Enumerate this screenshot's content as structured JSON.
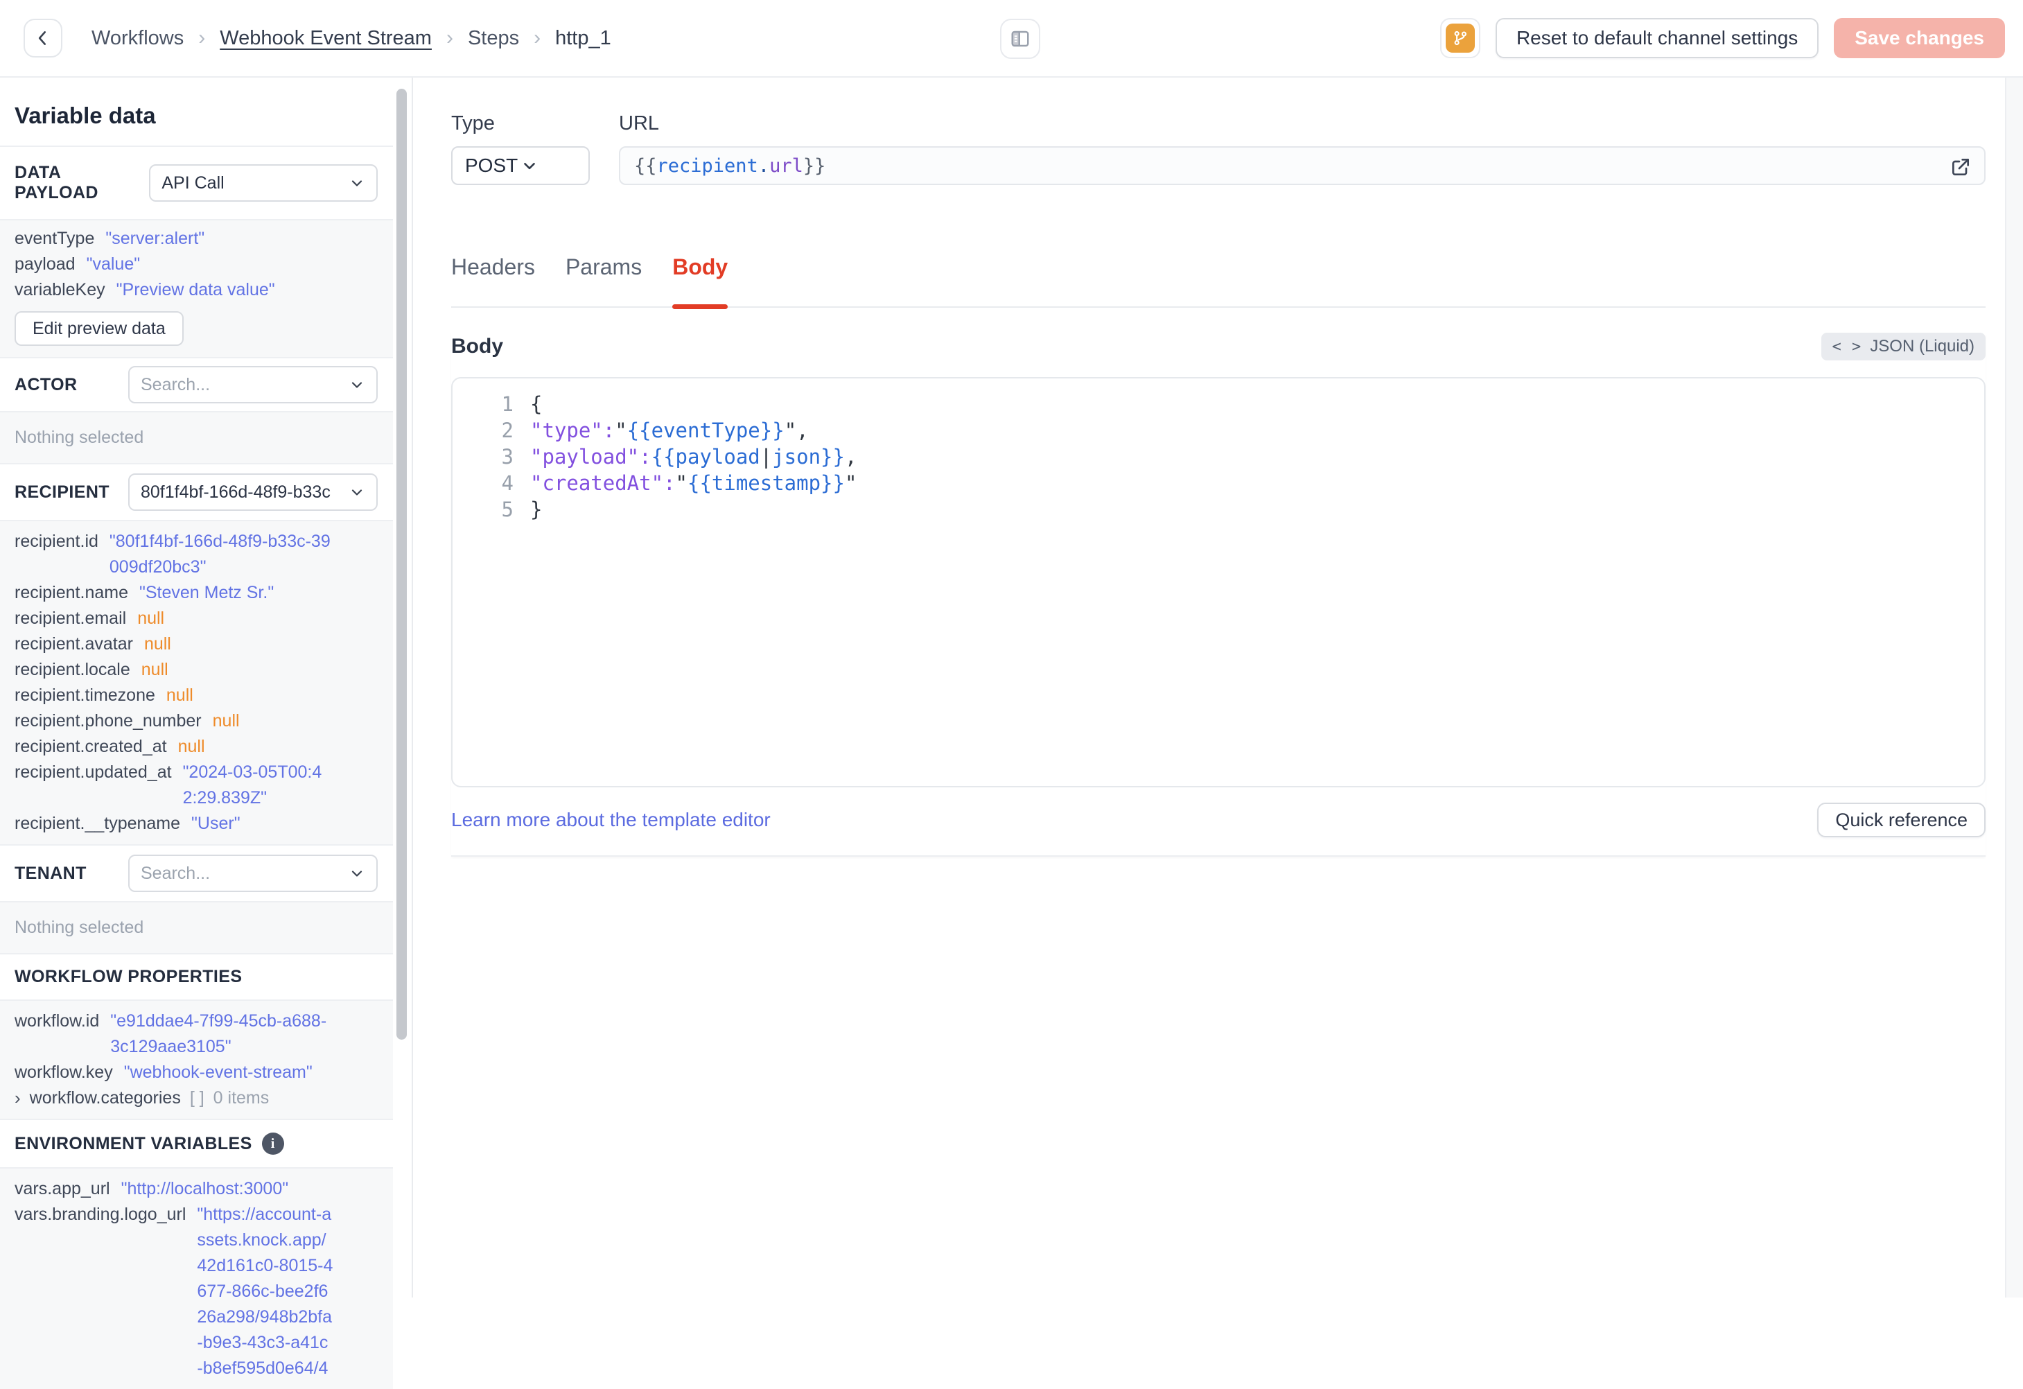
{
  "topbar": {
    "breadcrumb": {
      "separator": "›",
      "items": [
        {
          "label": "Workflows",
          "underline": false,
          "clickable": true
        },
        {
          "label": "Webhook Event Stream",
          "underline": true,
          "clickable": true
        },
        {
          "label": "Steps",
          "underline": false,
          "clickable": true
        },
        {
          "label": "http_1",
          "underline": false,
          "clickable": false
        }
      ]
    },
    "reset_button": "Reset to default channel settings",
    "save_button": "Save changes"
  },
  "sidebar": {
    "title": "Variable data",
    "data_payload": {
      "label": "DATA PAYLOAD",
      "selected": "API Call",
      "fields": [
        {
          "key": "eventType",
          "value": "\"server:alert\"",
          "type": "string"
        },
        {
          "key": "payload",
          "value": "\"value\"",
          "type": "string"
        },
        {
          "key": "variableKey",
          "value": "\"Preview data value\"",
          "type": "string"
        }
      ],
      "edit_button": "Edit preview data"
    },
    "actor": {
      "label": "ACTOR",
      "placeholder": "Search...",
      "empty": "Nothing selected"
    },
    "recipient": {
      "label": "RECIPIENT",
      "selected": "80f1f4bf-166d-48f9-b33c",
      "fields": [
        {
          "key": "recipient.id",
          "value": "\"80f1f4bf-166d-48f9-b33c-39009df20bc3\"",
          "type": "string"
        },
        {
          "key": "recipient.name",
          "value": "\"Steven Metz Sr.\"",
          "type": "string"
        },
        {
          "key": "recipient.email",
          "value": "null",
          "type": "null"
        },
        {
          "key": "recipient.avatar",
          "value": "null",
          "type": "null"
        },
        {
          "key": "recipient.locale",
          "value": "null",
          "type": "null"
        },
        {
          "key": "recipient.timezone",
          "value": "null",
          "type": "null"
        },
        {
          "key": "recipient.phone_number",
          "value": "null",
          "type": "null"
        },
        {
          "key": "recipient.created_at",
          "value": "null",
          "type": "null"
        },
        {
          "key": "recipient.updated_at",
          "value": "\"2024-03-05T00:42:29.839Z\"",
          "type": "string"
        },
        {
          "key": "recipient.__typename",
          "value": "\"User\"",
          "type": "string"
        }
      ]
    },
    "tenant": {
      "label": "TENANT",
      "placeholder": "Search...",
      "empty": "Nothing selected"
    },
    "workflow": {
      "label": "WORKFLOW PROPERTIES",
      "fields": [
        {
          "key": "workflow.id",
          "value": "\"e91ddae4-7f99-45cb-a688-3c129aae3105\"",
          "type": "string"
        },
        {
          "key": "workflow.key",
          "value": "\"webhook-event-stream\"",
          "type": "string"
        }
      ],
      "categories": {
        "chevron": "›",
        "key": "workflow.categories",
        "bracket": "[ ]",
        "count": "0 items"
      }
    },
    "env": {
      "label": "ENVIRONMENT VARIABLES",
      "fields": [
        {
          "key": "vars.app_url",
          "value": "\"http://localhost:3000\"",
          "type": "string"
        },
        {
          "key": "vars.branding.logo_url",
          "value": "\"https://account-assets.knock.app/42d161c0-8015-4677-866c-bee2f626a298/948b2bfa-b9e3-43c3-a41c-b8ef595d0e64/4",
          "type": "string"
        }
      ]
    }
  },
  "main": {
    "type_label": "Type",
    "method": "POST",
    "url_label": "URL",
    "url_tokens": [
      {
        "t": "{{",
        "c": "u-brace"
      },
      {
        "t": "recipient",
        "c": "u-blue"
      },
      {
        "t": ".",
        "c": "u-dot"
      },
      {
        "t": "url",
        "c": "u-purple"
      },
      {
        "t": "}}",
        "c": "u-brace"
      }
    ],
    "tabs": [
      "Headers",
      "Params",
      "Body"
    ],
    "active_tab": "Body",
    "body_label": "Body",
    "format_badge": {
      "glyph": "< >",
      "label": "JSON (Liquid)"
    },
    "code_lines": [
      {
        "num": "1",
        "tokens": [
          {
            "t": "{",
            "c": "t-punct"
          }
        ]
      },
      {
        "num": "2",
        "tokens": [
          {
            "t": "\"type\"",
            "c": "t-key"
          },
          {
            "t": ": ",
            "c": "t-key"
          },
          {
            "t": "\"",
            "c": "t-punct"
          },
          {
            "t": "{{eventType}}",
            "c": "t-liquid"
          },
          {
            "t": "\",",
            "c": "t-punct"
          }
        ]
      },
      {
        "num": "3",
        "tokens": [
          {
            "t": "\"payload\"",
            "c": "t-key"
          },
          {
            "t": ": ",
            "c": "t-key"
          },
          {
            "t": "{{payload ",
            "c": "t-liquid"
          },
          {
            "t": "|",
            "c": "t-punct"
          },
          {
            "t": " json}}",
            "c": "t-liquid"
          },
          {
            "t": ",",
            "c": "t-punct"
          }
        ]
      },
      {
        "num": "4",
        "tokens": [
          {
            "t": "\"createdAt\"",
            "c": "t-key"
          },
          {
            "t": ": ",
            "c": "t-key"
          },
          {
            "t": "\"",
            "c": "t-punct"
          },
          {
            "t": "{{timestamp}}",
            "c": "t-liquid"
          },
          {
            "t": "\"",
            "c": "t-punct"
          }
        ]
      },
      {
        "num": "5",
        "tokens": [
          {
            "t": "}",
            "c": "t-punct"
          }
        ]
      }
    ],
    "footer_link": "Learn more about the template editor",
    "quick_reference_button": "Quick reference"
  },
  "colors": {
    "accent_red": "#e23c25",
    "indigo_value": "#6273e4",
    "null_orange": "#ee8b2a",
    "brand_orange": "#eba23c",
    "save_disabled_bg": "#f5b3aa"
  }
}
